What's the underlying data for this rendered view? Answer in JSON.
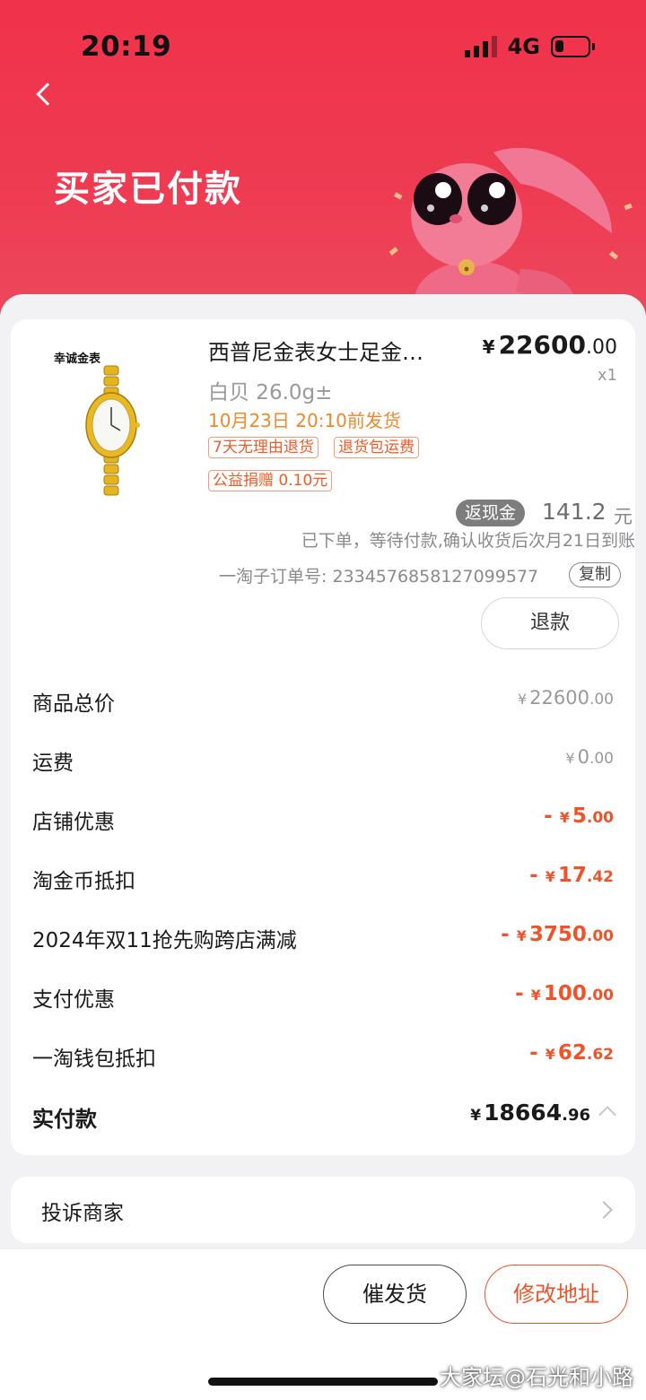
{
  "status_bar": {
    "time": "20:19",
    "network": "4G"
  },
  "header": {
    "title": "买家已付款"
  },
  "product": {
    "image_caption": "幸诚金表",
    "title": "西普尼金表女士足金…",
    "price_symbol": "¥",
    "price_int": "22600",
    "price_dec": ".00",
    "quantity": "x1",
    "spec": "白贝 26.0g±",
    "ship_time": "10月23日 20:10前发货",
    "tags": [
      "7天无理由退货",
      "退货包运费",
      "公益捐赠 0.10元"
    ]
  },
  "cashback": {
    "badge": "返现金",
    "amount": "141.2",
    "unit": "元",
    "note": "已下单，等待付款,确认收货后次月21日到账"
  },
  "order": {
    "number_text": "一淘子订单号: 2334576858127099577",
    "copy_label": "复制",
    "refund_label": "退款"
  },
  "price_rows": [
    {
      "label": "商品总价",
      "prefix": "",
      "symbol": "¥",
      "int": "22600",
      "dec": ".00",
      "style": "gray"
    },
    {
      "label": "运费",
      "prefix": "",
      "symbol": "¥",
      "int": "0",
      "dec": ".00",
      "style": "gray"
    },
    {
      "label": "店铺优惠",
      "prefix": "-",
      "symbol": "¥",
      "int": "5",
      "dec": ".00",
      "style": "red"
    },
    {
      "label": "淘金币抵扣",
      "prefix": "-",
      "symbol": "¥",
      "int": "17",
      "dec": ".42",
      "style": "red"
    },
    {
      "label": "2024年双11抢先购跨店满减",
      "prefix": "-",
      "symbol": "¥",
      "int": "3750",
      "dec": ".00",
      "style": "red"
    },
    {
      "label": "支付优惠",
      "prefix": "-",
      "symbol": "¥",
      "int": "100",
      "dec": ".00",
      "style": "red"
    },
    {
      "label": "一淘钱包抵扣",
      "prefix": "-",
      "symbol": "¥",
      "int": "62",
      "dec": ".62",
      "style": "red"
    }
  ],
  "total": {
    "label": "实付款",
    "symbol": "¥",
    "int": "18664",
    "dec": ".96"
  },
  "complain": {
    "label": "投诉商家"
  },
  "actions": {
    "urge_label": "催发货",
    "address_label": "修改地址"
  },
  "watermark": "大家坛@石光和小路",
  "colors": {
    "header_red": "#f0324a",
    "accent_orange": "#f0532a",
    "ship_orange": "#f0882a"
  }
}
